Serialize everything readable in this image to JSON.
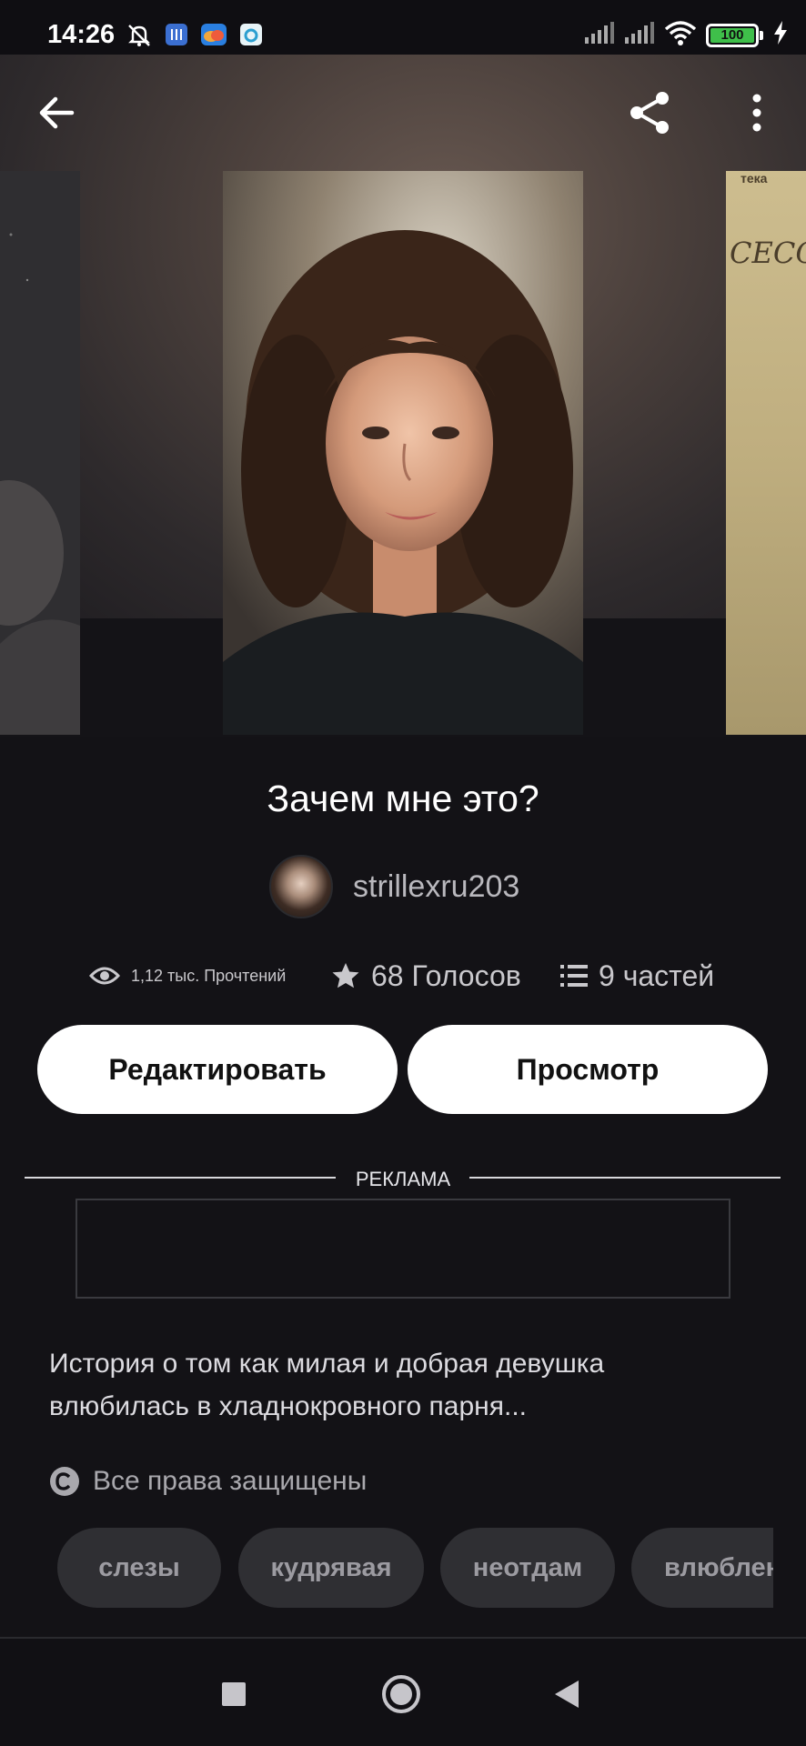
{
  "status_bar": {
    "time": "14:26",
    "battery": "100",
    "icons": [
      "silent-icon",
      "app-notification-icon",
      "cloud-icon",
      "app-icon",
      "signal-icon",
      "signal-icon",
      "wifi-icon",
      "charging-icon"
    ]
  },
  "top_bar": {
    "back_icon": "back-arrow-icon",
    "share_icon": "share-icon",
    "menu_icon": "more-vertical-icon"
  },
  "covers": {
    "right_peek_text": "СЕССИЯ",
    "right_peek_top": "тека"
  },
  "story": {
    "title": "Зачем мне это?",
    "author": "strillexru203",
    "stats": {
      "reads": "1,12 тыс. Прочтений",
      "votes": "68 Голосов",
      "parts": "9 частей"
    },
    "description": "История о том как милая и добрая девушка влюбилась в хладнокровного парня...",
    "copyright": "Все права защищены"
  },
  "buttons": {
    "edit": "Редактировать",
    "view": "Просмотр"
  },
  "ad": {
    "label": "РЕКЛАМА"
  },
  "tags": [
    "слезы",
    "кудрявая",
    "неотдам",
    "влюблен"
  ],
  "nav_bar": {
    "icons": [
      "recents-icon",
      "home-icon",
      "back-icon"
    ]
  },
  "colors": {
    "background": "#131216",
    "button_bg": "#ffffff",
    "tag_bg": "#2f2f33",
    "battery_green": "#3fbf4a"
  }
}
